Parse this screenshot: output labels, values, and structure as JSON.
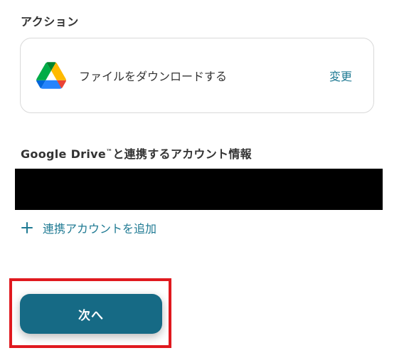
{
  "action_section": {
    "heading": "アクション",
    "action": {
      "icon": "google-drive-icon",
      "name": "ファイルをダウンロードする",
      "change_label": "変更"
    }
  },
  "account_section": {
    "heading_main": "Google Drive",
    "heading_tm": "™",
    "heading_rest": "と連携するアカウント情報",
    "add_account_label": "連携アカウントを追加",
    "add_account_icon": "plus-icon"
  },
  "footer": {
    "next_label": "次へ"
  },
  "colors": {
    "accent": "#1f7a93",
    "button": "#166a85",
    "highlight": "#e0191f",
    "drive_green": "#1fa463",
    "drive_yellow": "#ffd04b",
    "drive_blue": "#4688f4"
  }
}
